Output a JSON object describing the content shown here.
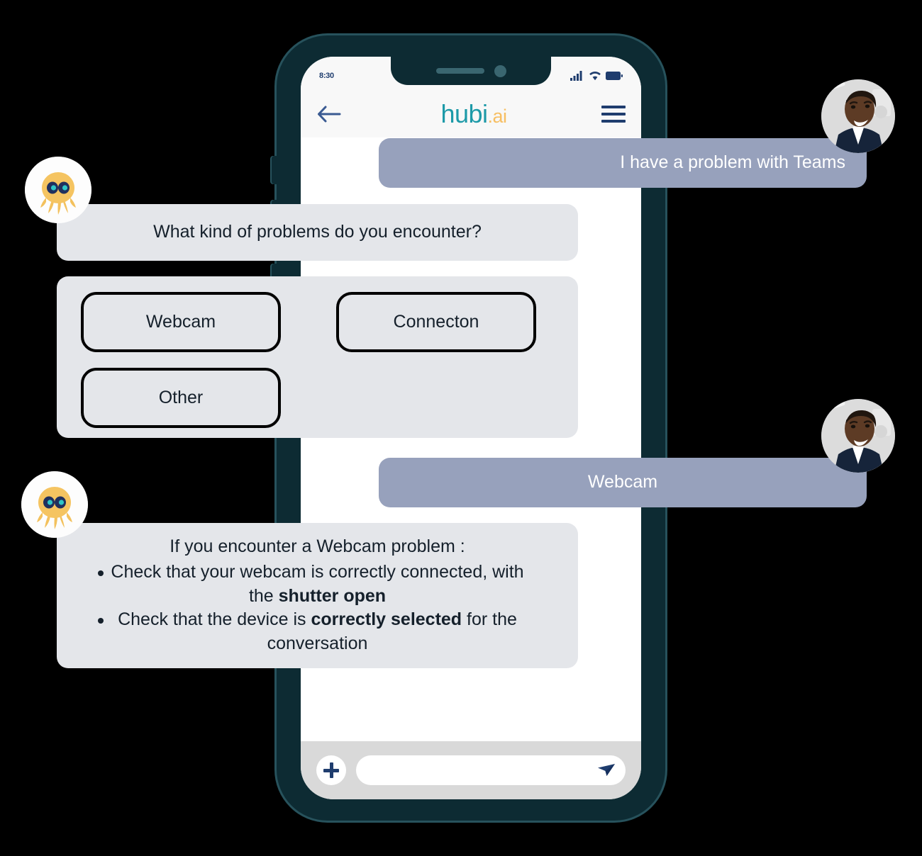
{
  "device": {
    "status_bar": {
      "time": "8:30",
      "icons": [
        "signal-bars-icon",
        "wifi-icon",
        "battery-icon"
      ]
    },
    "notch": {
      "speaker": "earpiece-speaker",
      "camera": "front-camera"
    }
  },
  "header": {
    "back_icon": "back-arrow-icon",
    "logo_primary": "hubi",
    "logo_suffix": ".ai",
    "menu_icon": "hamburger-menu-icon",
    "colors": {
      "logo_primary": "#1d9aa8",
      "logo_suffix": "#f7bf63",
      "icon": "#1f3d6e"
    }
  },
  "conversation": {
    "messages": [
      {
        "id": "msg-user-1",
        "sender": "user",
        "text": "I have a problem with Teams",
        "avatar": "user-photo-avatar"
      },
      {
        "id": "msg-bot-1",
        "sender": "bot",
        "text": "What kind of problems do you encounter?",
        "avatar": "octopus-bot-avatar"
      },
      {
        "id": "msg-user-2",
        "sender": "user",
        "text": "Webcam",
        "avatar": "user-photo-avatar"
      }
    ],
    "quick_replies": {
      "options": [
        "Webcam",
        "Connecton",
        "Other"
      ]
    },
    "bot_answer": {
      "heading": "If you encounter a Webcam problem :",
      "bullets": [
        {
          "plain_before": "Check that your webcam is correctly connected, with the ",
          "bold": "shutter open",
          "plain_after": ""
        },
        {
          "plain_before": "Check that the device is ",
          "bold": "correctly selected",
          "plain_after": " for the conversation"
        }
      ]
    }
  },
  "composer": {
    "add_icon": "plus-icon",
    "input_value": "",
    "input_placeholder": "",
    "send_icon": "send-paper-plane-icon"
  },
  "theme": {
    "background": "#000000",
    "phone_body": "#0d2b33",
    "phone_rim": "#27525c",
    "screen": "#ffffff",
    "status_bar_bg": "#f8f8f8",
    "bot_bubble": "#e4e6ea",
    "user_bubble": "#97a1bc",
    "user_bubble_text": "#ffffff",
    "composer_bg": "#d9d9d9",
    "text": "#15202b"
  }
}
